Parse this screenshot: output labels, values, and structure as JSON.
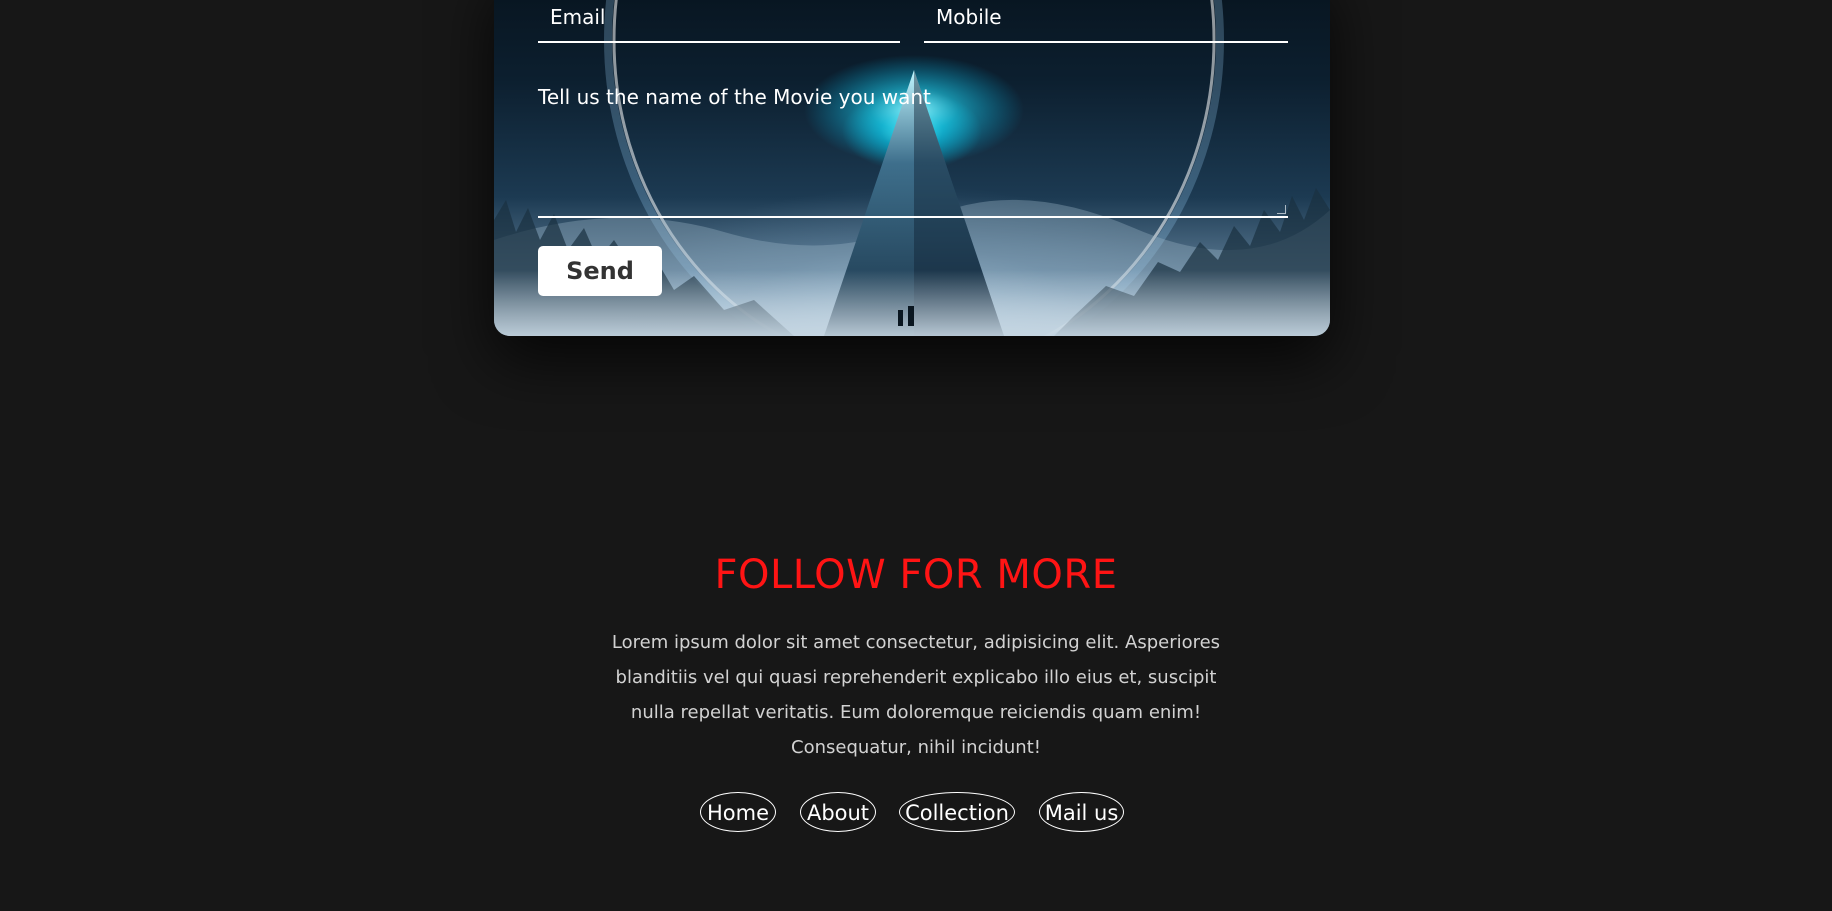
{
  "contact_form": {
    "email_label": "Email",
    "mobile_label": "Mobile",
    "message_placeholder": "Tell us the name of the Movie you want",
    "send_label": "Send"
  },
  "follow": {
    "title": "FOLLOW FOR MORE",
    "text": "Lorem ipsum dolor sit amet consectetur, adipisicing elit. Asperiores blanditiis vel qui quasi reprehenderit explicabo illo eius et, suscipit nulla repellat veritatis. Eum doloremque reiciendis quam enim! Consequatur, nihil incidunt!"
  },
  "footer_nav": {
    "items": [
      {
        "label": "Home"
      },
      {
        "label": "About"
      },
      {
        "label": "Collection"
      },
      {
        "label": "Mail us"
      }
    ]
  },
  "colors": {
    "page_background": "#171717",
    "accent": "#ff1414",
    "text_light": "#d2d2d2"
  }
}
